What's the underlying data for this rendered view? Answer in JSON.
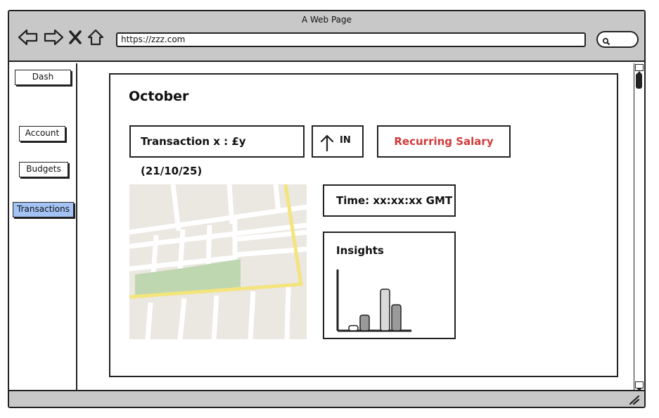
{
  "window": {
    "title": "A Web Page",
    "url": "https://zzz.com"
  },
  "sidebar": {
    "items": [
      {
        "label": "Dash"
      },
      {
        "label": "Account"
      },
      {
        "label": "Budgets"
      },
      {
        "label": "Transactions",
        "active": true
      }
    ]
  },
  "main": {
    "month": "October",
    "transaction": "Transaction x : £y (21/10/25)",
    "direction": {
      "label": "IN",
      "icon": "arrow-up-icon"
    },
    "category": {
      "label": "Recurring Salary",
      "color": "#d13b3b"
    },
    "time": "Time: xx:xx:xx GMT",
    "insights": {
      "title": "Insights",
      "chart_data": {
        "type": "bar",
        "values": [
          1,
          3,
          8,
          5
        ]
      }
    }
  },
  "colors": {
    "chrome": "#c8c8c8",
    "active_item": "#a3c3f5",
    "accent_red": "#d13b3b"
  }
}
